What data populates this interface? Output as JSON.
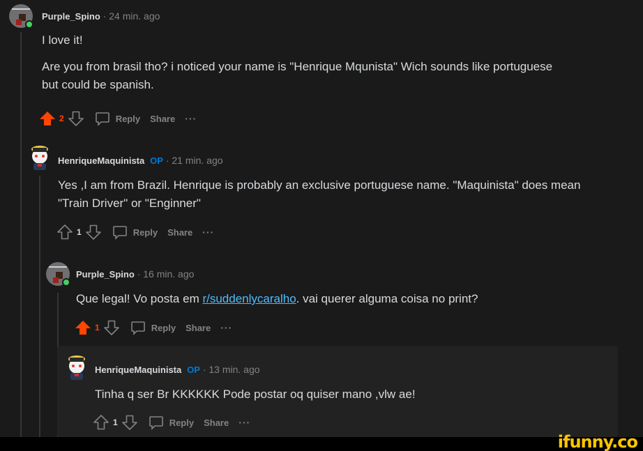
{
  "comments": [
    {
      "author": "Purple_Spino",
      "time": "· 24 min. ago",
      "paragraphs": [
        "I love it!",
        "Are you from brasil tho? i noticed your name is \"Henrique Mqunista\" Wich sounds like portuguese but could be spanish."
      ],
      "score": "2",
      "upvoted": true
    },
    {
      "author": "HenriqueMaquinista",
      "op": "OP",
      "time": "· 21 min. ago",
      "paragraphs": [
        "Yes ,I am from Brazil. Henrique is probably an exclusive portuguese name. \"Maquinista\" does mean \"Train Driver\" or \"Enginner\""
      ],
      "score": "1",
      "upvoted": false
    },
    {
      "author": "Purple_Spino",
      "time": "· 16 min. ago",
      "text_before": "Que legal! Vo posta em ",
      "link": "r/suddenlycaralho",
      "text_after": ". vai querer alguma coisa no print?",
      "score": "1",
      "upvoted": true
    },
    {
      "author": "HenriqueMaquinista",
      "op": "OP",
      "time": "· 13 min. ago",
      "paragraphs": [
        "Tinha q ser Br KKKKKK Pode postar oq quiser mano ,vlw ae!"
      ],
      "score": "1",
      "upvoted": false
    }
  ],
  "actions": {
    "reply": "Reply",
    "share": "Share",
    "more": "···"
  },
  "watermark": "ifunny.co",
  "colors": {
    "upvote": "#ff4500",
    "op": "#0079d3",
    "link": "#4fbcff",
    "online": "#46d160",
    "watermark": "#ffc600"
  },
  "icons": [
    "upvote-arrow-icon",
    "downvote-arrow-icon",
    "comment-bubble-icon",
    "online-status-icon",
    "user-avatar-icon"
  ]
}
